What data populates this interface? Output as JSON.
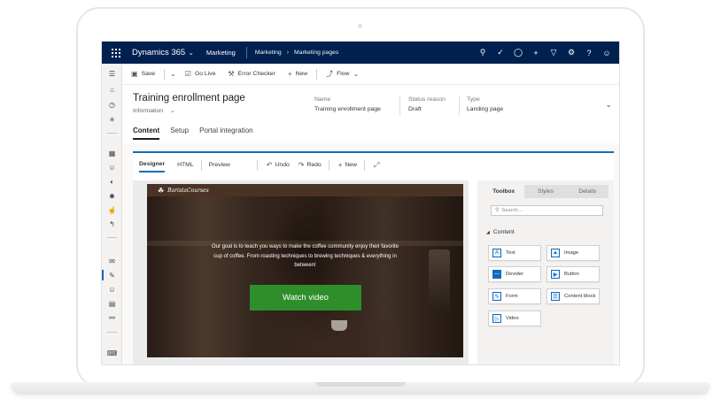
{
  "nav": {
    "brand": "Dynamics 365",
    "area": "Marketing",
    "crumb1": "Marketing",
    "crumb2": "Marketing pages",
    "icons": [
      "search-icon",
      "task-icon",
      "lightbulb-icon",
      "plus-icon",
      "filter-icon",
      "settings-icon",
      "help-icon",
      "user-icon"
    ]
  },
  "commands": {
    "save": "Save",
    "golive": "Go Live",
    "checker": "Error Checker",
    "new": "New",
    "flow": "Flow"
  },
  "header": {
    "title": "Training enrollment page",
    "subtitle": "Information",
    "fields": [
      {
        "label": "Name",
        "value": "Training enrollment page"
      },
      {
        "label": "Status reason",
        "value": "Draft"
      },
      {
        "label": "Type",
        "value": "Landing page"
      }
    ],
    "tabs": [
      "Content",
      "Setup",
      "Portal integration"
    ]
  },
  "designer": {
    "tabs": [
      "Designer",
      "HTML",
      "Preview"
    ],
    "undo": "Undo",
    "redo": "Redo",
    "new": "New"
  },
  "email": {
    "logo": "BaristaCourses",
    "message": "Our goal is to teach you ways to make the coffee community enjoy their favorite cup of coffee. From roasting techniques to brewing techniques & everything in between!",
    "cta": "Watch video"
  },
  "toolbox": {
    "tabs": [
      "Toolbox",
      "Styles",
      "Details"
    ],
    "search_placeholder": "Search...",
    "section": "Content",
    "items": [
      "Text",
      "Image",
      "Devider",
      "Button",
      "Form",
      "Content block",
      "Video"
    ]
  },
  "colors": {
    "navbar": "#002050",
    "accent": "#0f6cbd",
    "cta": "#2e8f2a"
  }
}
